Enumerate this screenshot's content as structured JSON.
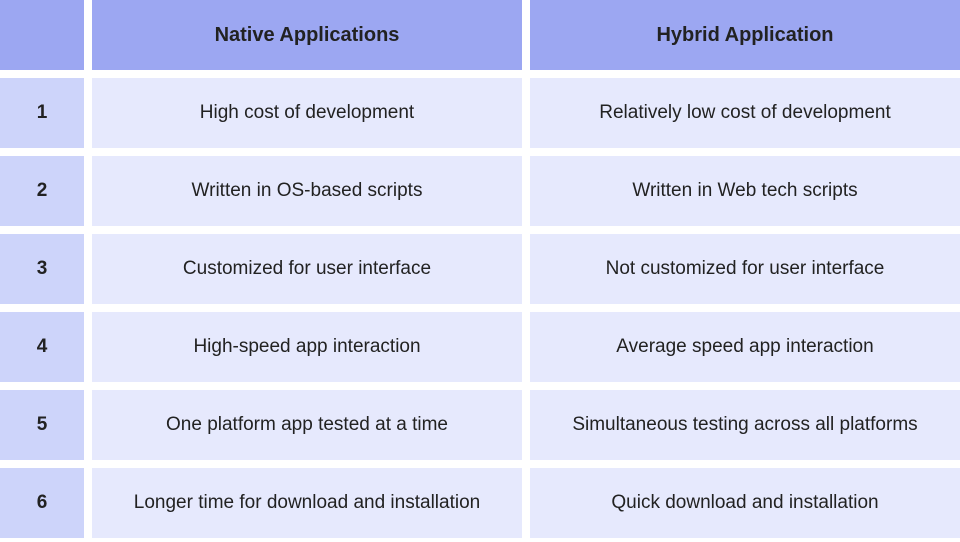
{
  "chart_data": {
    "type": "table",
    "columns": [
      "Native Applications",
      "Hybrid Application"
    ],
    "rows": [
      {
        "idx": "1",
        "native": "High cost of development",
        "hybrid": "Relatively low cost of development"
      },
      {
        "idx": "2",
        "native": "Written in OS-based scripts",
        "hybrid": "Written in Web tech scripts"
      },
      {
        "idx": "3",
        "native": "Customized for user interface",
        "hybrid": "Not customized for user interface"
      },
      {
        "idx": "4",
        "native": "High-speed app interaction",
        "hybrid": "Average speed app interaction"
      },
      {
        "idx": "5",
        "native": "One platform app tested at a time",
        "hybrid": "Simultaneous testing across all platforms"
      },
      {
        "idx": "6",
        "native": "Longer time for download and installation",
        "hybrid": "Quick download and installation"
      }
    ]
  }
}
